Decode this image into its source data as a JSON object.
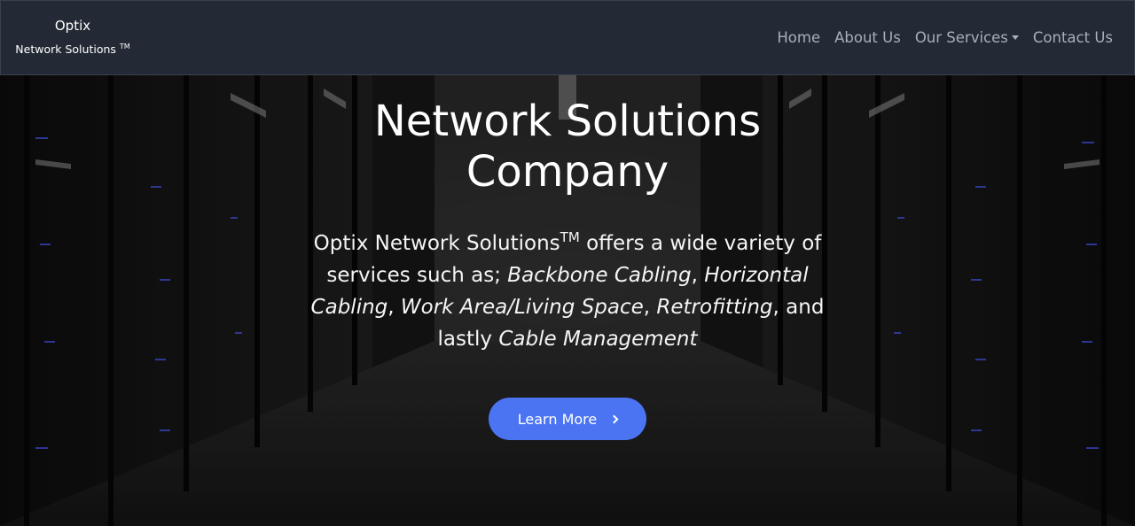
{
  "brand": {
    "top": "Optix",
    "bottom": "Network Solutions",
    "tm": "TM"
  },
  "nav": {
    "home": "Home",
    "about": "About Us",
    "services": "Our Services",
    "contact": "Contact Us"
  },
  "hero": {
    "title": "Network Solutions Company",
    "text": {
      "company": "Optix Network Solutions",
      "tm": "TM",
      "intro": " offers a wide variety of services such as; ",
      "s1": "Backbone Cabling",
      "sep1": ", ",
      "s2": "Horizontal Cabling",
      "sep2": ", ",
      "s3": "Work Area/Living Space",
      "sep3": ", ",
      "s4": "Retrofitting",
      "sep4": ", and lastly ",
      "s5": "Cable Management"
    },
    "button": "Learn More",
    "button_icon": "chevron-right-icon"
  },
  "colors": {
    "navbar_bg": "#242a35",
    "nav_link": "#a8afb9",
    "accent_button": "#4a74f2"
  }
}
